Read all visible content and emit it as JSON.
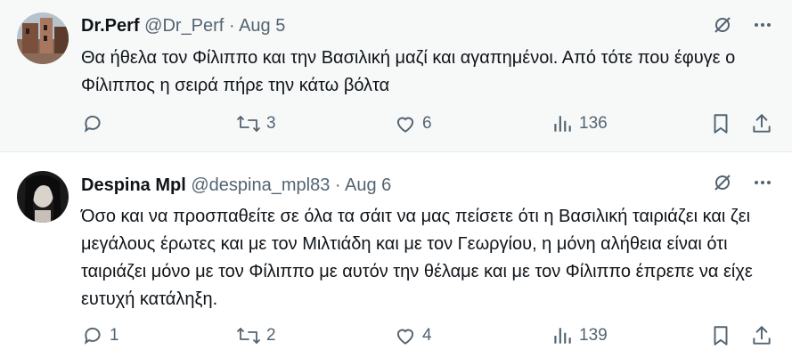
{
  "tweets": [
    {
      "name": "Dr.Perf",
      "handle": "@Dr_Perf",
      "separator": "·",
      "date": "Aug 5",
      "text": "Θα ήθελα τον Φίλιππο και την Βασιλική μαζί και αγαπημένοι. Από τότε που έφυγε ο Φίλιππος η σειρά πήρε την κάτω βόλτα",
      "replies": "",
      "retweets": "3",
      "likes": "6",
      "views": "136"
    },
    {
      "name": "Despina Mpl",
      "handle": "@despina_mpl83",
      "separator": "·",
      "date": "Aug 6",
      "text": "Όσο και να προσπαθείτε σε όλα τα σάιτ να μας πείσετε ότι η Βασιλική ταιριάζει και ζει μεγάλους έρωτες και με τον Μιλτιάδη και με τον Γεωργίου, η μόνη αλήθεια είναι ότι ταιριάζει μόνο με τον Φίλιππο με αυτόν την θέλαμε και με τον Φίλιππο έπρεπε να είχε ευτυχή κατάληξη.",
      "replies": "1",
      "retweets": "2",
      "likes": "4",
      "views": "139"
    }
  ],
  "icons": {
    "top": [
      "grok-icon",
      "more-icon"
    ],
    "actions": [
      "reply-icon",
      "retweet-icon",
      "like-icon",
      "views-icon",
      "bookmark-icon",
      "share-icon"
    ]
  },
  "colors": {
    "text": "#0f1419",
    "muted": "#536471",
    "highlight_bg": "#f7f9f9"
  }
}
